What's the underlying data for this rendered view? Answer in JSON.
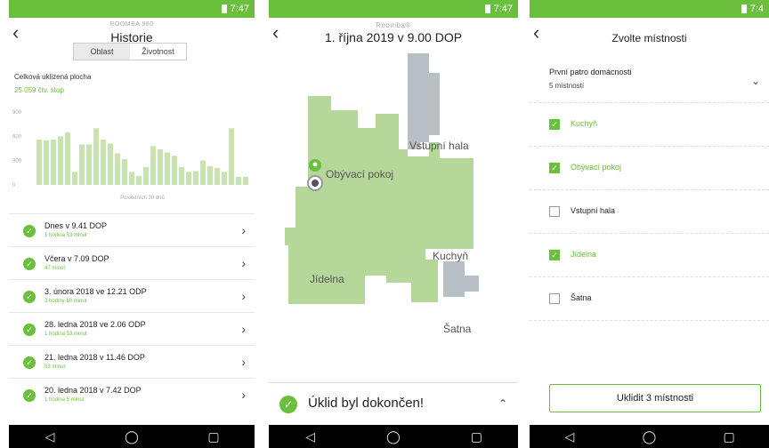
{
  "status": {
    "time": "7:47",
    "time_cut": "7:4"
  },
  "history": {
    "subtitle": "ROOMBA 980",
    "title": "Historie",
    "tabs": [
      "Oblast",
      "Životnost"
    ],
    "total_label": "Celková uklizená plocha",
    "total_value": "25 059 čtv. stop",
    "items": [
      {
        "title": "Dnes v 9.41 DOP",
        "duration": "1 hodina 53 minut"
      },
      {
        "title": "Včera v 7.09 DOP",
        "duration": "47 minut"
      },
      {
        "title": "3. února 2018 ve 12.21 ODP",
        "duration": "3 hodiny 50 minut"
      },
      {
        "title": "28. ledna 2018 ve 2.06 ODP",
        "duration": "1 hodina 53 minut"
      },
      {
        "title": "21. ledna 2018 v 11.46 DOP",
        "duration": "53 minut"
      },
      {
        "title": "20. ledna 2018 v 7.42 DOP",
        "duration": "1 hodina 5 minut"
      }
    ]
  },
  "chart_data": {
    "type": "bar",
    "xlabel": "Posledních 30 dnů",
    "ylabel": "",
    "yticks": [
      "900",
      "600",
      "300",
      "0"
    ],
    "ylim": [
      0,
      900
    ],
    "values": [
      560,
      550,
      560,
      600,
      650,
      160,
      500,
      500,
      700,
      560,
      510,
      390,
      320,
      160,
      110,
      220,
      480,
      440,
      400,
      360,
      220,
      160,
      170,
      300,
      230,
      210,
      160,
      700,
      100,
      100
    ],
    "colors": {
      "bar": "#c7e3ae",
      "axis_text": "#aaaaaa"
    }
  },
  "map": {
    "subtitle": "Roomba®",
    "title": "1. října 2019 v 9.00 DOP",
    "rooms": [
      "Vstupní hala",
      "Obývací pokoj",
      "Kuchyň",
      "Jídelna",
      "Šatna"
    ],
    "done_text": "Úklid byl dokončen!",
    "colors": {
      "clean": "#b5d89a",
      "dark": "#9ab884",
      "hall": "#b8c0c5"
    }
  },
  "rooms_select": {
    "title": "Zvolte místnosti",
    "floor_name": "První patro domácnosti",
    "floor_count": "5 místností",
    "rooms": [
      {
        "name": "Kuchyň",
        "checked": true
      },
      {
        "name": "Obývací pokoj",
        "checked": true
      },
      {
        "name": "Vstupní hala",
        "checked": false
      },
      {
        "name": "Jídelna",
        "checked": true
      },
      {
        "name": "Šatna",
        "checked": false
      }
    ],
    "button": "Uklidit 3 místnosti"
  },
  "icons": {
    "back": "back-arrow-icon",
    "chevron": "chevron-right-icon",
    "check": "check-circle-icon"
  }
}
